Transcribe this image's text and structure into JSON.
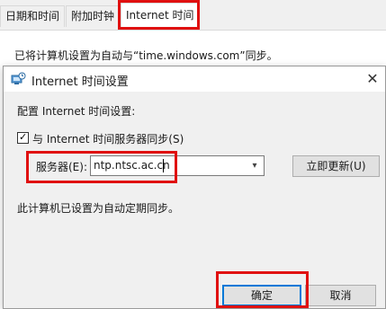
{
  "tabs": [
    {
      "label": "日期和时间"
    },
    {
      "label": "附加时钟"
    },
    {
      "label": "Internet 时间"
    }
  ],
  "background_info": "已将计算机设置为自动与“time.windows.com”同步。",
  "dialog": {
    "title": "Internet 时间设置",
    "config_label": "配置 Internet 时间设置:",
    "sync_checkbox_label": "与 Internet 时间服务器同步(S)",
    "sync_checked": true,
    "server_label": "服务器(E):",
    "server_value": "ntp.ntsc.ac.cn",
    "update_button": "立即更新(U)",
    "status_text": "此计算机已设置为自动定期同步。",
    "ok_button": "确定",
    "cancel_button": "取消"
  },
  "colors": {
    "highlight_red": "#e01010",
    "focus_blue": "#0078d7",
    "dialog_bg": "#f0f0f0"
  },
  "icons": [
    "internet-time-icon",
    "close-icon",
    "checkbox-check-icon",
    "dropdown-caret-icon"
  ]
}
